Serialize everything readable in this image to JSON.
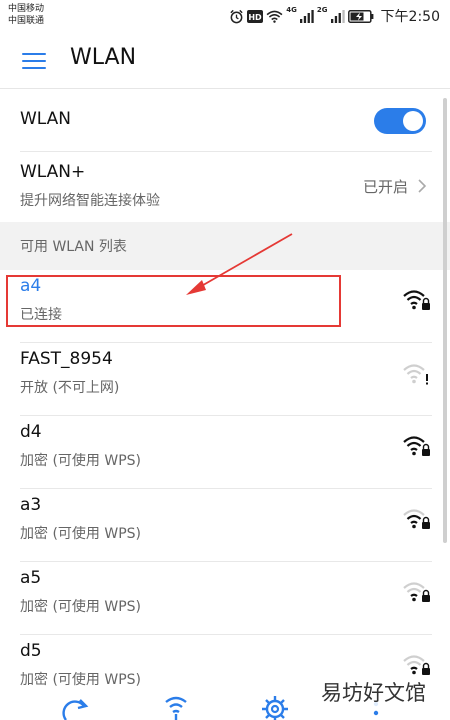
{
  "status_bar": {
    "carrier_1": "中国移动",
    "carrier_2": "中国联通",
    "network_1": "4G",
    "network_2": "2G",
    "time": "下午2:50",
    "icons": [
      "alarm-icon",
      "hd-icon",
      "wifi-icon",
      "signal-icon",
      "battery-icon"
    ]
  },
  "app_bar": {
    "title": "WLAN",
    "menu_icon": "menu-icon"
  },
  "wlan_toggle": {
    "label": "WLAN",
    "enabled": true
  },
  "wlan_plus": {
    "label": "WLAN+",
    "description": "提升网络智能连接体验",
    "status": "已开启"
  },
  "section_header": "可用 WLAN 列表",
  "networks": [
    {
      "name": "a4",
      "status": "已连接",
      "connected": true,
      "secured": true,
      "signal": "strong"
    },
    {
      "name": "FAST_8954",
      "status": "开放 (不可上网)",
      "connected": false,
      "secured": false,
      "signal": "weak"
    },
    {
      "name": "d4",
      "status": "加密 (可使用 WPS)",
      "connected": false,
      "secured": true,
      "signal": "strong"
    },
    {
      "name": "a3",
      "status": "加密 (可使用 WPS)",
      "connected": false,
      "secured": true,
      "signal": "medium"
    },
    {
      "name": "a5",
      "status": "加密 (可使用 WPS)",
      "connected": false,
      "secured": true,
      "signal": "weak"
    },
    {
      "name": "d5",
      "status": "加密 (可使用 WPS)",
      "connected": false,
      "secured": true,
      "signal": "weak"
    }
  ],
  "watermark": "易坊好文馆",
  "colors": {
    "accent": "#2b7de9",
    "highlight": "#e53935",
    "secondary_text": "#666666",
    "section_bg": "#f2f2f2"
  }
}
